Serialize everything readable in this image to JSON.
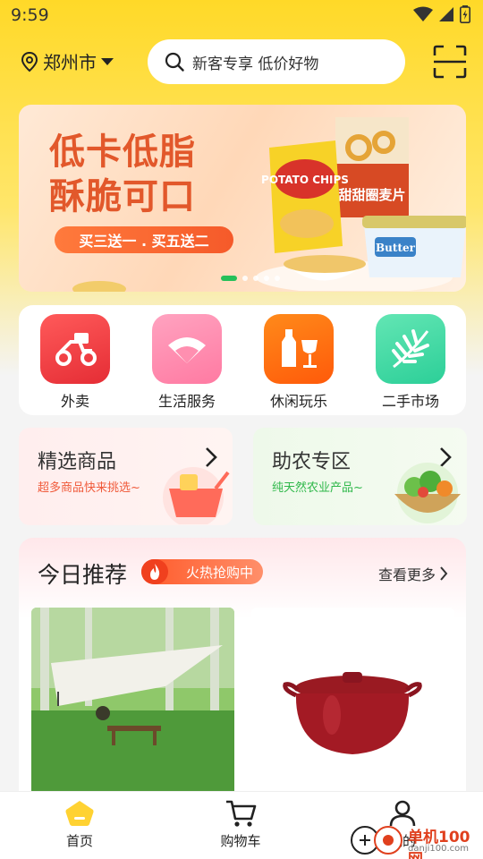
{
  "status_bar": {
    "time": "9:59",
    "icons": [
      "wifi-icon",
      "signal-icon",
      "battery-charging-icon"
    ]
  },
  "header": {
    "location": "郑州市",
    "search_placeholder": "新客专享 低价好物",
    "scan_icon": "scan-icon"
  },
  "banner": {
    "title_line1": "低卡低脂",
    "title_line2": "酥脆可口",
    "promo": "买三送一 . 买五送二",
    "product_chips": "POTATO CHIPS",
    "product_cereal": "甜甜圈麦片",
    "product_butter": "Butter",
    "active_slide": 1,
    "slide_count": 5
  },
  "categories": [
    {
      "label": "外卖",
      "icon": "scooter-icon",
      "color": "#ef3d3f"
    },
    {
      "label": "生活服务",
      "icon": "fan-icon",
      "color": "#ff7fa6"
    },
    {
      "label": "休闲玩乐",
      "icon": "drinks-icon",
      "color": "#ff6b12"
    },
    {
      "label": "二手市场",
      "icon": "leaf-icon",
      "color": "#3ed6a0"
    }
  ],
  "promo_cards": [
    {
      "title": "精选商品",
      "subtitle": "超多商品快来挑选~",
      "subtitle_color": "#f05a3a"
    },
    {
      "title": "助农专区",
      "subtitle": "纯天然农业产品~",
      "subtitle_color": "#2fb84a"
    }
  ],
  "today": {
    "title": "今日推荐",
    "hot_badge": "火热抢购中",
    "more": "查看更多"
  },
  "bottom_nav": [
    {
      "label": "首页",
      "icon": "home-icon",
      "active": true
    },
    {
      "label": "购物车",
      "icon": "cart-icon",
      "active": false
    },
    {
      "label": "我的",
      "icon": "user-icon",
      "active": false
    }
  ],
  "watermark": {
    "text": "单机100网",
    "url": "danji100.com"
  },
  "colors": {
    "brand_yellow": "#ffd928",
    "accent_orange": "#f55a2a",
    "accent_green": "#25c05a"
  }
}
